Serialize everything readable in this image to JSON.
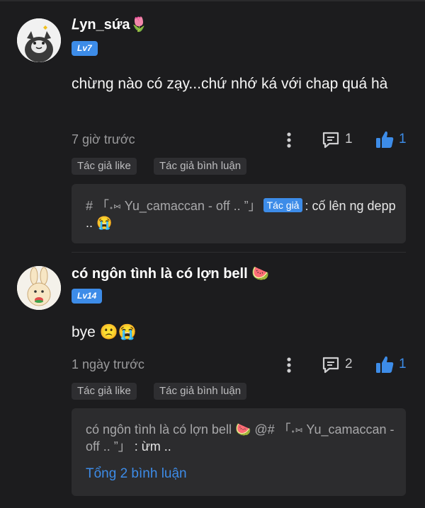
{
  "comments": [
    {
      "username": "𝐿yn_sứa",
      "username_emoji": "🌷",
      "level": "Lv7",
      "text": "chừng nào có zạy...chứ nhớ ká với chap quá hà",
      "time": "7 giờ trước",
      "reply_count": "1",
      "like_count": "1",
      "tags": [
        "Tác giả like",
        "Tác giả bình luận"
      ],
      "reply": {
        "prefix": "# 「˖⑅ Yu_camaccan - off .. ”」",
        "badge": "Tác giả",
        "text": ": cố lên ng depp .. 😭"
      }
    },
    {
      "username": "có ngôn tình là có lợn bell 🍉",
      "level": "Lv14",
      "text": "bye 🙁😭",
      "time": "1 ngày trước",
      "reply_count": "2",
      "like_count": "1",
      "tags": [
        "Tác giả like",
        "Tác giả bình luận"
      ],
      "reply": {
        "prefix": "có ngôn tình là có lợn bell 🍉 @# 「˖⑅ Yu_camaccan - off .. ”」",
        "text": ": ừm .."
      },
      "total_replies_link": "Tổng 2 bình luận"
    }
  ],
  "colors": {
    "background": "#1c1c1e",
    "accent": "#3d8ce8",
    "tag_bg": "#2e2e31",
    "reply_box_bg": "#2c2c2e"
  },
  "icons": {
    "more": "more-vertical-icon",
    "reply": "comment-bubble-icon",
    "like": "thumbs-up-icon"
  }
}
